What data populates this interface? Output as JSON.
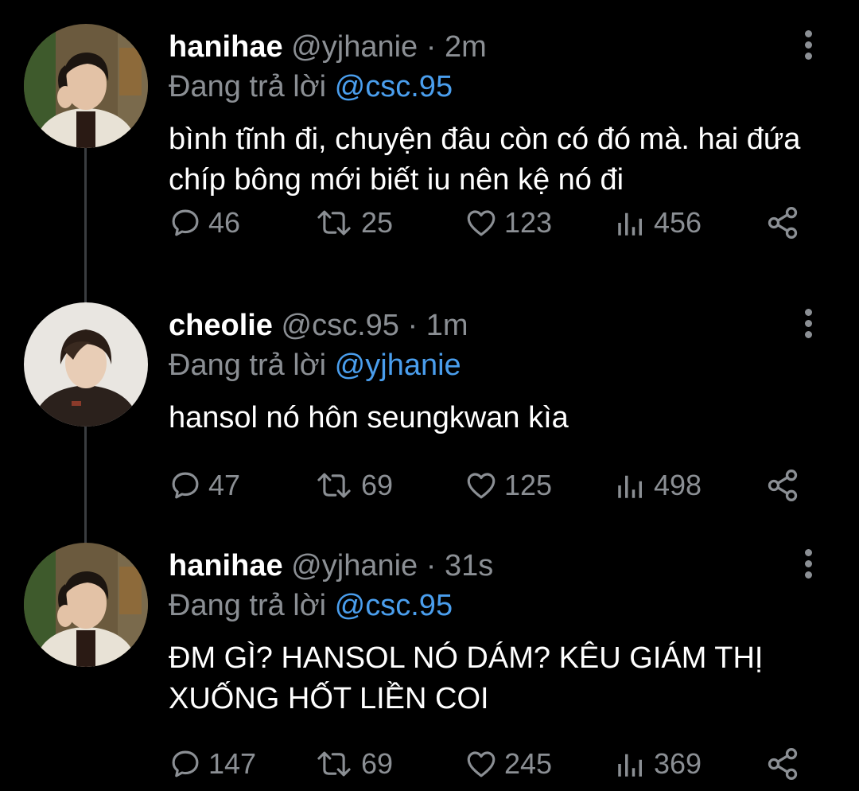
{
  "tweets": [
    {
      "name": "hanihae",
      "handle": "@yjhanie",
      "separator": "·",
      "time": "2m",
      "reply_prefix": "Đang trả lời",
      "reply_to": "@csc.95",
      "text": "bình tĩnh đi, chuyện đâu còn có đó mà. hai đứa chíp bông mới biết iu nên kệ nó đi",
      "replies": "46",
      "retweets": "25",
      "likes": "123",
      "views": "456",
      "avatar": "avatar-photo-hanihae"
    },
    {
      "name": "cheolie",
      "handle": "@csc.95",
      "separator": "·",
      "time": "1m",
      "reply_prefix": "Đang trả lời",
      "reply_to": "@yjhanie",
      "text": "hansol nó hôn seungkwan kìa",
      "replies": "47",
      "retweets": "69",
      "likes": "125",
      "views": "498",
      "avatar": "avatar-photo-cheolie"
    },
    {
      "name": "hanihae",
      "handle": "@yjhanie",
      "separator": "·",
      "time": "31s",
      "reply_prefix": "Đang trả lời",
      "reply_to": "@csc.95",
      "text": "ĐM GÌ? HANSOL NÓ DÁM? KÊU GIÁM THỊ XUỐNG HỐT LIỀN COI",
      "replies": "147",
      "retweets": "69",
      "likes": "245",
      "views": "369",
      "avatar": "avatar-photo-hanihae"
    }
  ],
  "colors": {
    "background": "#000000",
    "text": "#ffffff",
    "muted": "#8b8f94",
    "accent": "#4a9eed",
    "thread_line": "#3a3d40"
  }
}
